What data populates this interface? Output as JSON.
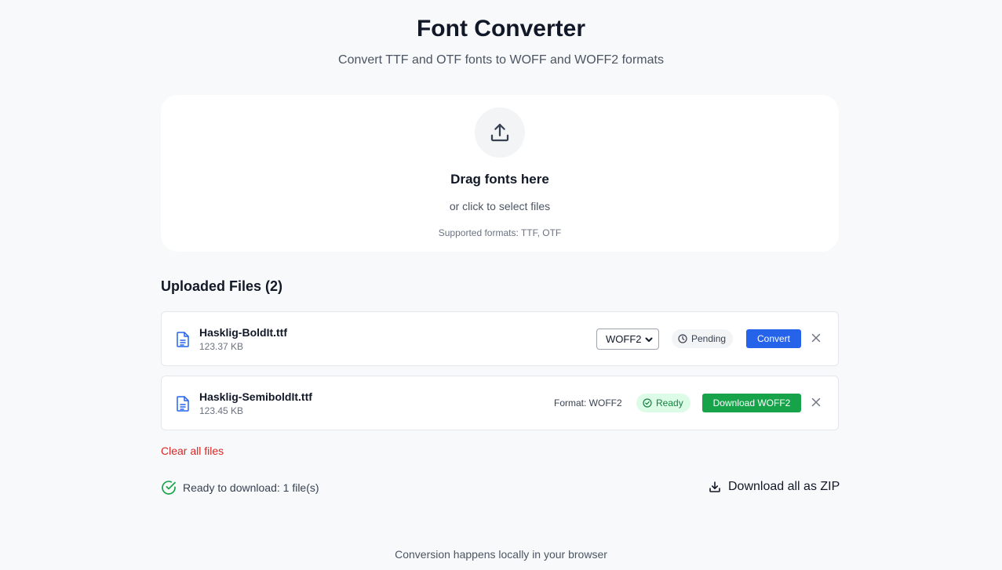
{
  "header": {
    "title": "Font Converter",
    "subtitle": "Convert TTF and OTF fonts to WOFF and WOFF2 formats"
  },
  "dropzone": {
    "icon": "upload-icon",
    "title": "Drag fonts here",
    "subtitle": "or click to select files",
    "formats": "Supported formats: TTF, OTF"
  },
  "files": {
    "heading": "Uploaded Files (2)",
    "items": [
      {
        "name": "Hasklig-BoldIt.ttf",
        "size": "123.37 KB",
        "selected_format": "WOFF2",
        "status": "Pending",
        "action": "Convert"
      },
      {
        "name": "Hasklig-SemiboldIt.ttf",
        "size": "123.45 KB",
        "format_label": "Format: WOFF2",
        "status": "Ready",
        "action": "Download WOFF2"
      }
    ],
    "clear_all": "Clear all files"
  },
  "summary": {
    "ready_text": "Ready to download: 1 file(s)",
    "zip_label": "Download all as ZIP"
  },
  "footer": {
    "text": "Conversion happens locally in your browser"
  },
  "colors": {
    "accent_blue": "#2563eb",
    "success_green": "#16a34a",
    "danger_red": "#dc2626",
    "background": "#f8f9fa"
  }
}
